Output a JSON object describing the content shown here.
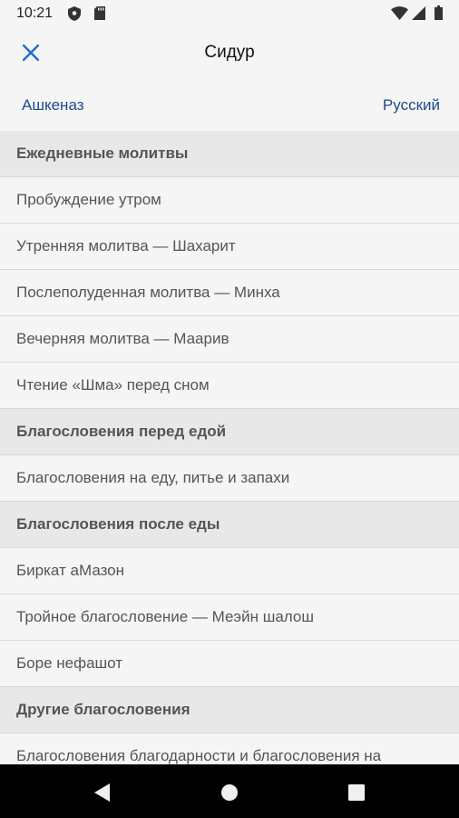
{
  "status_bar": {
    "time": "10:21",
    "icons": [
      "shield-icon",
      "sd-card-icon",
      "wifi-icon",
      "signal-icon",
      "battery-icon"
    ]
  },
  "app_bar": {
    "title": "Сидур",
    "close_icon": "close-icon"
  },
  "sub_bar": {
    "rite": "Ашкеназ",
    "language": "Русский"
  },
  "list": [
    {
      "type": "section",
      "label": "Ежедневные молитвы"
    },
    {
      "type": "item",
      "label": "Пробуждение утром"
    },
    {
      "type": "item",
      "label": "Утренняя молитва — Шахарит"
    },
    {
      "type": "item",
      "label": "Послеполуденная молитва — Минха"
    },
    {
      "type": "item",
      "label": "Вечерняя молитва — Маарив"
    },
    {
      "type": "item",
      "label": "Чтение «Шма» перед сном"
    },
    {
      "type": "section",
      "label": "Благословения перед едой"
    },
    {
      "type": "item",
      "label": "Благословения на еду, питье и запахи"
    },
    {
      "type": "section",
      "label": "Благословения после еды"
    },
    {
      "type": "item",
      "label": "Биркат аМазон"
    },
    {
      "type": "item",
      "label": "Тройное благословение — Меэйн шалош"
    },
    {
      "type": "item",
      "label": "Боре нефашот"
    },
    {
      "type": "section",
      "label": "Другие благословения"
    },
    {
      "type": "item",
      "label": "Благословения благодарности и благословения на"
    }
  ],
  "nav_bar": {
    "buttons": [
      "back-icon",
      "home-icon",
      "recents-icon"
    ]
  },
  "colors": {
    "accent": "#1a4b8c",
    "close_icon": "#1e6fd0",
    "background": "#f5f5f5",
    "section_bg": "#e8e8e8"
  }
}
